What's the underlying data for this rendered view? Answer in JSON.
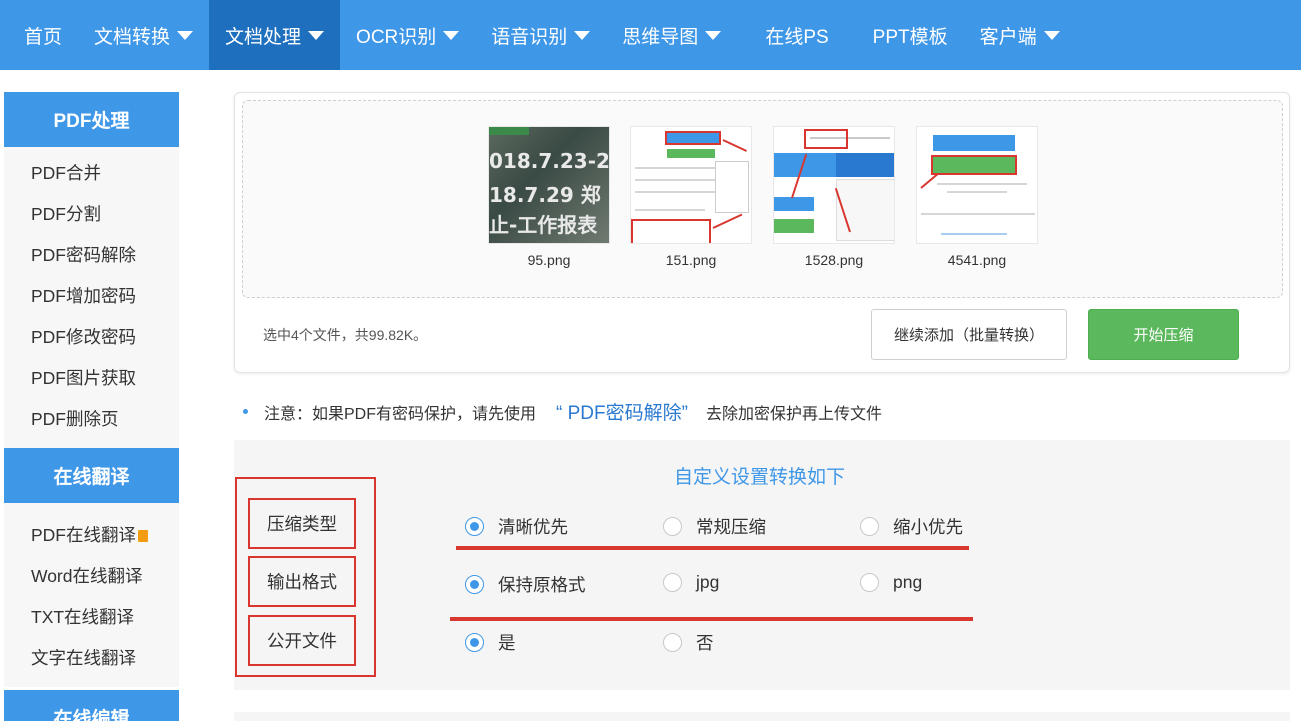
{
  "nav": {
    "items": [
      {
        "label": "首页",
        "dropdown": false,
        "active": false
      },
      {
        "label": "文档转换",
        "dropdown": true,
        "active": false
      },
      {
        "label": "文档处理",
        "dropdown": true,
        "active": true
      },
      {
        "label": "OCR识别",
        "dropdown": true,
        "active": false
      },
      {
        "label": "语音识别",
        "dropdown": true,
        "active": false
      },
      {
        "label": "思维导图",
        "dropdown": true,
        "active": false
      },
      {
        "label": "在线PS",
        "dropdown": false,
        "active": false
      },
      {
        "label": "PPT模板",
        "dropdown": false,
        "active": false
      },
      {
        "label": "客户端",
        "dropdown": true,
        "active": false
      }
    ]
  },
  "sidebar": {
    "sections": [
      {
        "title": "PDF处理",
        "items": [
          "PDF合并",
          "PDF分割",
          "PDF密码解除",
          "PDF增加密码",
          "PDF修改密码",
          "PDF图片获取",
          "PDF删除页"
        ]
      },
      {
        "title": "在线翻译",
        "items": [
          "PDF在线翻译",
          "Word在线翻译",
          "TXT在线翻译",
          "文字在线翻译"
        ]
      },
      {
        "title": "在线编辑",
        "items": []
      }
    ]
  },
  "upload": {
    "files": [
      {
        "name": "95.png",
        "thumb_lines": [
          "018.7.23-2",
          "18.7.29 郑",
          "止-工作报表"
        ]
      },
      {
        "name": "151.png"
      },
      {
        "name": "1528.png"
      },
      {
        "name": "4541.png"
      }
    ],
    "selection_info": "选中4个文件，共99.82K。",
    "add_button": "继续添加（批量转换）",
    "start_button": "开始压缩"
  },
  "notice": {
    "prefix": "注意：如果PDF有密码保护，请先使用",
    "link": "“ PDF密码解除”",
    "suffix": "去除加密保护再上传文件"
  },
  "settings": {
    "title": "自定义设置转换如下",
    "rows": [
      {
        "label": "压缩类型",
        "options": [
          "清晰优先",
          "常规压缩",
          "缩小优先"
        ],
        "selected": 0
      },
      {
        "label": "输出格式",
        "options": [
          "保持原格式",
          "jpg",
          "png"
        ],
        "selected": 0
      },
      {
        "label": "公开文件",
        "options": [
          "是",
          "否"
        ],
        "selected": 0
      }
    ]
  },
  "colors": {
    "nav_bg": "#3f97e8",
    "nav_active": "#1f6fbf",
    "accent": "#3f97e8",
    "start_button": "#5cb85c",
    "annotation_red": "#d9362f"
  }
}
